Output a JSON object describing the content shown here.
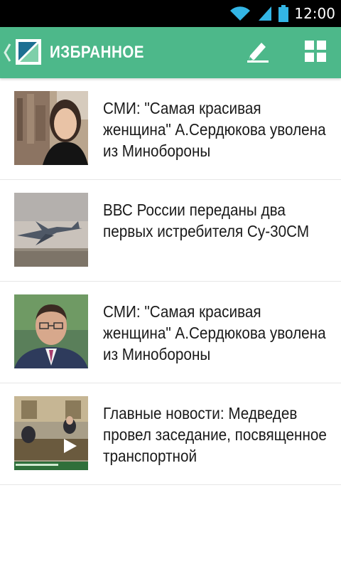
{
  "status_bar": {
    "time": "12:00",
    "icons": [
      "wifi-icon",
      "signal-icon",
      "battery-icon"
    ]
  },
  "action_bar": {
    "title": "ИЗБРАННОЕ",
    "background_color": "#4db88a",
    "icons": [
      "back-chevron-icon",
      "app-logo-icon",
      "edit-icon",
      "grid-view-icon"
    ]
  },
  "news": [
    {
      "headline": "СМИ: \"Самая красивая женщина\" А.Сердюкова уволена из Минобороны",
      "thumbnail": "woman-portrait-image"
    },
    {
      "headline": "ВВС России переданы два первых истребителя Су-30СМ",
      "thumbnail": "fighter-jet-image"
    },
    {
      "headline": "СМИ: \"Самая красивая женщина\" А.Сердюкова уволена из Минобороны",
      "thumbnail": "man-portrait-image"
    },
    {
      "headline": "Главные новости: Медведев провел заседание, посвященное транспортной",
      "thumbnail": "video-meeting-image"
    }
  ]
}
